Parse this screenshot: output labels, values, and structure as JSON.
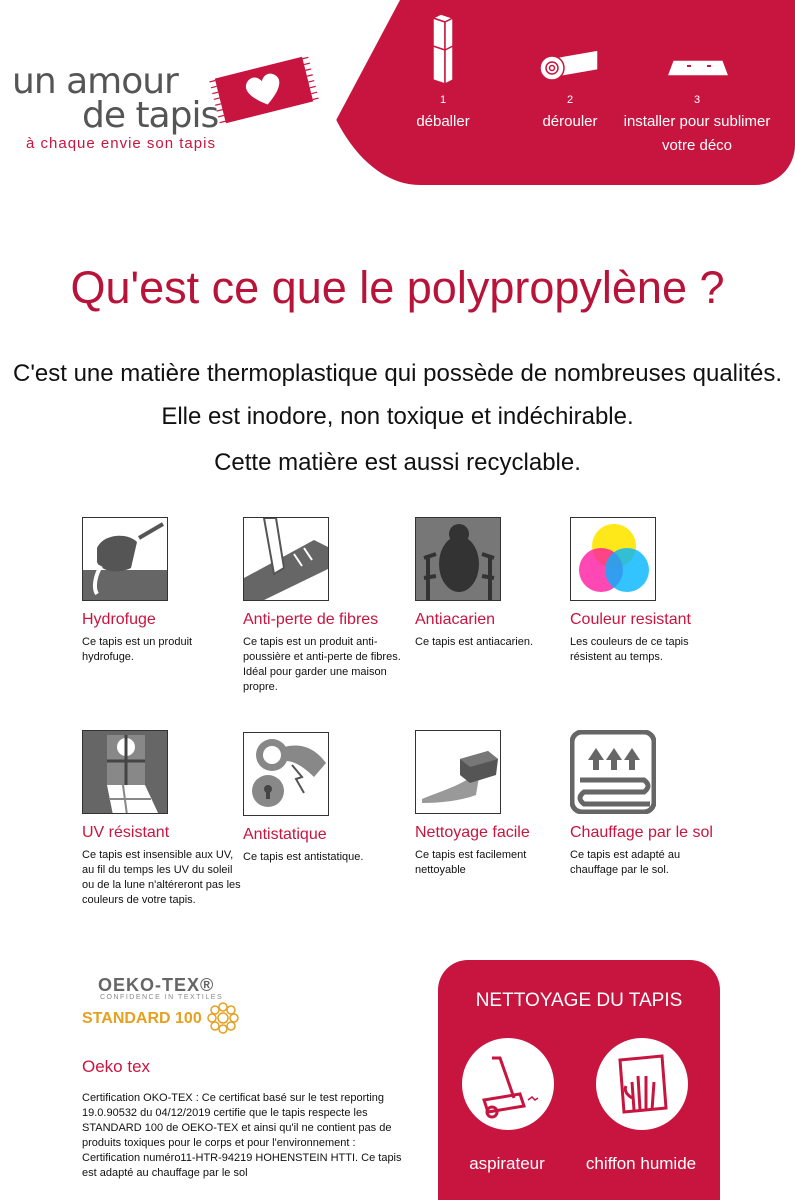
{
  "logo": {
    "line1": "un amour",
    "line2": "de tapis",
    "tagline": "à chaque envie son tapis"
  },
  "steps": [
    {
      "num": "1",
      "label": "déballer",
      "icon": "box-icon"
    },
    {
      "num": "2",
      "label": "dérouler",
      "icon": "rolled-rug-icon"
    },
    {
      "num": "3",
      "label": "installer pour sublimer votre déco",
      "icon": "flat-rug-icon"
    }
  ],
  "title": "Qu'est ce que le polypropylène ?",
  "intro": [
    "C'est une matière thermoplastique qui possède de nombreuses qualités.",
    "Elle est inodore, non toxique et indéchirable.",
    "Cette matière est aussi recyclable."
  ],
  "features": [
    {
      "name": "Hydrofuge",
      "desc": "Ce tapis est un produit hydrofuge.",
      "icon": "water-pour-icon"
    },
    {
      "name": "Anti-perte de fibres",
      "desc": "Ce tapis est un produit anti-poussière et anti-perte de fibres. Idéal pour garder une maison propre.",
      "icon": "vacuum-nozzle-icon"
    },
    {
      "name": "Antiacarien",
      "desc": "Ce tapis est antiacarien.",
      "icon": "mite-icon"
    },
    {
      "name": "Couleur resistant",
      "desc": "Les couleurs de ce tapis résistent au temps.",
      "icon": "color-circles-icon"
    },
    {
      "name": "UV résistant",
      "desc": "Ce tapis est insensible aux UV, au fil du temps les UV du soleil ou de la lune n'altéreront pas les couleurs de votre tapis.",
      "icon": "window-sun-icon"
    },
    {
      "name": "Antistatique",
      "desc": "Ce tapis est antistatique.",
      "icon": "antistatic-icon"
    },
    {
      "name": "Nettoyage facile",
      "desc": "Ce tapis est facilement nettoyable",
      "icon": "sponge-hand-icon"
    },
    {
      "name": "Chauffage par le sol",
      "desc": "Ce tapis est adapté au chauffage par le sol.",
      "icon": "floor-heating-icon"
    }
  ],
  "oeko": {
    "brand": "OEKO-TEX®",
    "confidence": "CONFIDENCE IN TEXTILES",
    "standard": "STANDARD 100",
    "name": "Oeko tex",
    "desc": "Certification OKO-TEX : Ce certificat basé sur le test reporting 19.0.90532 du 04/12/2019 certifie que le tapis respecte les STANDARD 100 de OEKO-TEX et ainsi qu'il ne contient pas de produits toxiques pour le corps et pour l'environnement : Certification numéro11-HTR-94219 HOHENSTEIN HTTI. Ce tapis est adapté au chauffage par le sol"
  },
  "cleaning": {
    "heading": "NETTOYAGE DU TAPIS",
    "items": [
      {
        "label": "aspirateur",
        "icon": "vacuum-icon"
      },
      {
        "label": "chiffon humide",
        "icon": "wet-cloth-icon"
      }
    ]
  },
  "colors": {
    "brand_red": "#c8153f",
    "title_red": "#b81338"
  }
}
